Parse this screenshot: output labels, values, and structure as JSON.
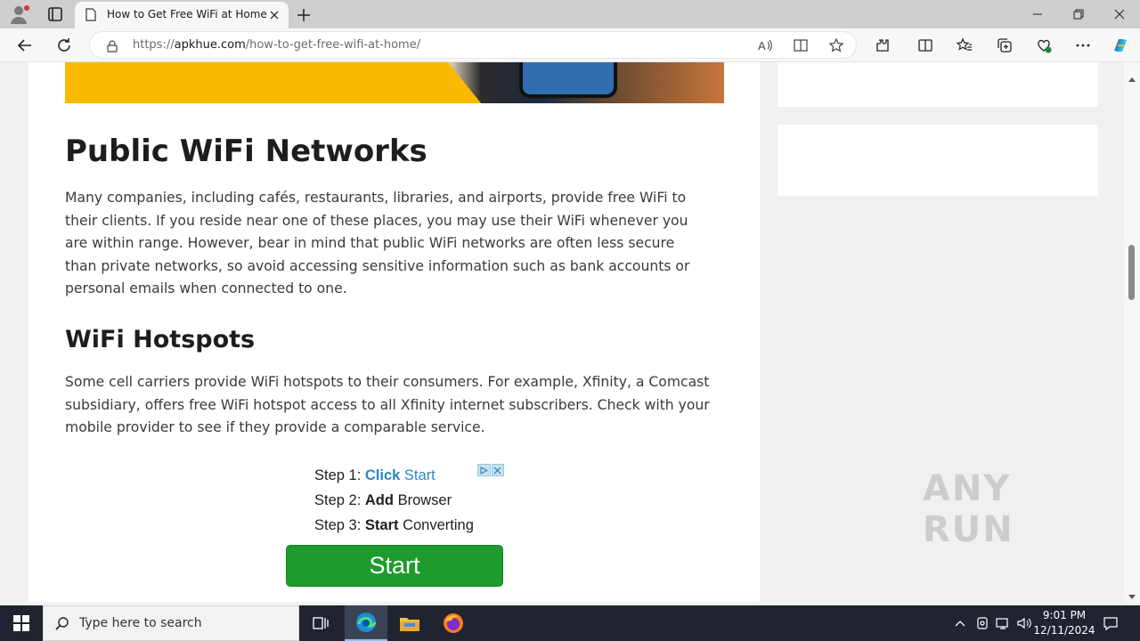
{
  "browser": {
    "tab": {
      "title": "How to Get Free WiFi at Home"
    },
    "url": {
      "scheme": "https://",
      "host": "apkhue.com",
      "path": "/how-to-get-free-wifi-at-home/"
    }
  },
  "article": {
    "section1": {
      "heading": "Public WiFi Networks",
      "body": "Many companies, including cafés, restaurants, libraries, and airports, provide free WiFi to their clients. If you reside near one of these places, you may use their WiFi whenever you are within range. However, bear in mind that public WiFi networks are often less secure than private networks, so avoid accessing sensitive information such as bank accounts or personal emails when connected to one."
    },
    "section2": {
      "heading": "WiFi Hotspots",
      "body": "Some cell carriers provide WiFi hotspots to their consumers. For example, Xfinity, a Comcast subsidiary, offers free WiFi hotspot access to all Xfinity internet subscribers. Check with your mobile provider to see if they provide a comparable service."
    }
  },
  "ad": {
    "step1_label": "Step 1:",
    "step1_bold": "Click",
    "step1_rest": "Start",
    "step2_label": "Step 2:",
    "step2_bold": "Add",
    "step2_rest": "Browser",
    "step3_label": "Step 3:",
    "step3_bold": "Start",
    "step3_rest": "Converting",
    "button_label": "Start"
  },
  "watermark": "ANY RUN",
  "taskbar": {
    "search_placeholder": "Type here to search",
    "time": "9:01 PM",
    "date": "12/11/2024"
  },
  "colors": {
    "ad_button": "#1e9b2c",
    "ad_link": "#2b87c5",
    "taskbar": "#1f2430"
  }
}
